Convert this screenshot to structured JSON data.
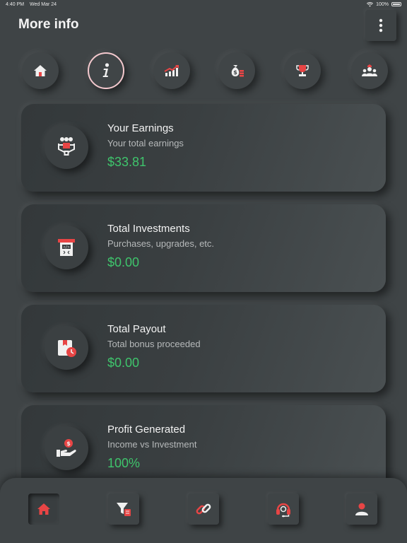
{
  "status_bar": {
    "time": "4:40 PM",
    "date": "Wed Mar 24",
    "battery": "100%"
  },
  "header": {
    "title": "More info",
    "menu_icon": "vertical-dots-icon"
  },
  "nav": [
    {
      "icon": "home-icon",
      "active": false
    },
    {
      "icon": "info-icon",
      "active": true
    },
    {
      "icon": "growth-chart-icon",
      "active": false
    },
    {
      "icon": "money-bag-icon",
      "active": false
    },
    {
      "icon": "trophy-icon",
      "active": false
    },
    {
      "icon": "team-icon",
      "active": false
    }
  ],
  "cards": [
    {
      "icon": "earnings-network-icon",
      "title": "Your Earnings",
      "subtitle": "Your total earnings",
      "value": "$33.81"
    },
    {
      "icon": "investment-kiosk-icon",
      "title": "Total Investments",
      "subtitle": "Purchases, upgrades, etc.",
      "value": "$0.00"
    },
    {
      "icon": "payout-clock-icon",
      "title": "Total Payout",
      "subtitle": "Total bonus proceeded",
      "value": "$0.00"
    },
    {
      "icon": "profit-hand-coin-icon",
      "title": "Profit Generated",
      "subtitle": "Income vs Investment",
      "value": "100%"
    }
  ],
  "bottom_tabs": [
    {
      "icon": "home-icon",
      "active": true
    },
    {
      "icon": "funnel-icon",
      "active": false
    },
    {
      "icon": "link-icon",
      "active": false
    },
    {
      "icon": "headset-icon",
      "active": false
    },
    {
      "icon": "user-icon",
      "active": false
    }
  ],
  "colors": {
    "accent": "#e84545",
    "value_green": "#3fc46c",
    "background": "#3f4446"
  }
}
